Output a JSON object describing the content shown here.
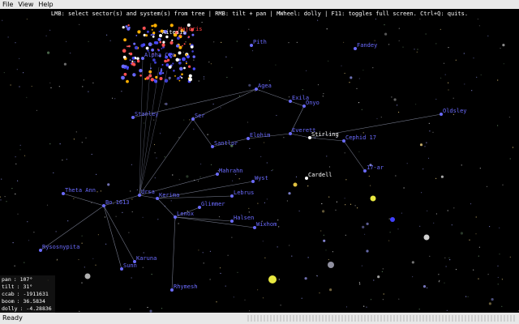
{
  "menu": {
    "file": "File",
    "view": "View",
    "help": "Help"
  },
  "hint": "LMB: select sector(s) and system(s) from tree | RMB: tilt + pan | MWheel: dolly | F11: toggles full screen. Ctrl+Q: quits.",
  "readout": [
    {
      "key": "pan",
      "value": ": 107°"
    },
    {
      "key": "tilt",
      "value": ": 31°"
    },
    {
      "key": "ccab",
      "value": ": -1911631"
    },
    {
      "key": "boom",
      "value": ": 36.5834"
    },
    {
      "key": "dolly",
      "value": ": -4.28836"
    }
  ],
  "status": "Ready",
  "systems": [
    {
      "label": "Majoris",
      "color": "#ff4040"
    },
    {
      "label": "Aitesis",
      "color": "#ffffff"
    },
    {
      "label": "Alpha Cro",
      "color": "#6b6bff"
    },
    {
      "label": "Pith",
      "color": "#6b6bff"
    },
    {
      "label": "Fandey",
      "color": "#6b6bff"
    },
    {
      "label": "Agea",
      "color": "#6b6bff"
    },
    {
      "label": "Exila",
      "color": "#6b6bff"
    },
    {
      "label": "Onyo",
      "color": "#6b6bff"
    },
    {
      "label": "Oldsley",
      "color": "#6b6bff"
    },
    {
      "label": "Stanley",
      "color": "#6b6bff"
    },
    {
      "label": "Ser",
      "color": "#6b6bff"
    },
    {
      "label": "Elohim",
      "color": "#6b6bff"
    },
    {
      "label": "Everett",
      "color": "#6b6bff"
    },
    {
      "label": "Stirling",
      "color": "#ffffff"
    },
    {
      "label": "Cephid 17",
      "color": "#6b6bff"
    },
    {
      "label": "Santlor",
      "color": "#6b6bff"
    },
    {
      "label": "17-ar",
      "color": "#6b6bff"
    },
    {
      "label": "Cardell",
      "color": "#ffffff"
    },
    {
      "label": "Mahrahn",
      "color": "#6b6bff"
    },
    {
      "label": "Wyst",
      "color": "#6b6bff"
    },
    {
      "label": "Theta Ann",
      "color": "#6b6bff"
    },
    {
      "label": "Ursa",
      "color": "#6b6bff"
    },
    {
      "label": "Kerima",
      "color": "#6b6bff"
    },
    {
      "label": "Lebrus",
      "color": "#6b6bff"
    },
    {
      "label": "Bo 1613",
      "color": "#6b6bff"
    },
    {
      "label": "Lenox",
      "color": "#6b6bff"
    },
    {
      "label": "Glimmer",
      "color": "#6b6bff"
    },
    {
      "label": "Halsen",
      "color": "#6b6bff"
    },
    {
      "label": "Wixhom",
      "color": "#6b6bff"
    },
    {
      "label": "Rysosnypita",
      "color": "#6b6bff"
    },
    {
      "label": "Karuna",
      "color": "#6b6bff"
    },
    {
      "label": "Sunn",
      "color": "#6b6bff"
    },
    {
      "label": "Rhymesh",
      "color": "#6b6bff"
    }
  ]
}
